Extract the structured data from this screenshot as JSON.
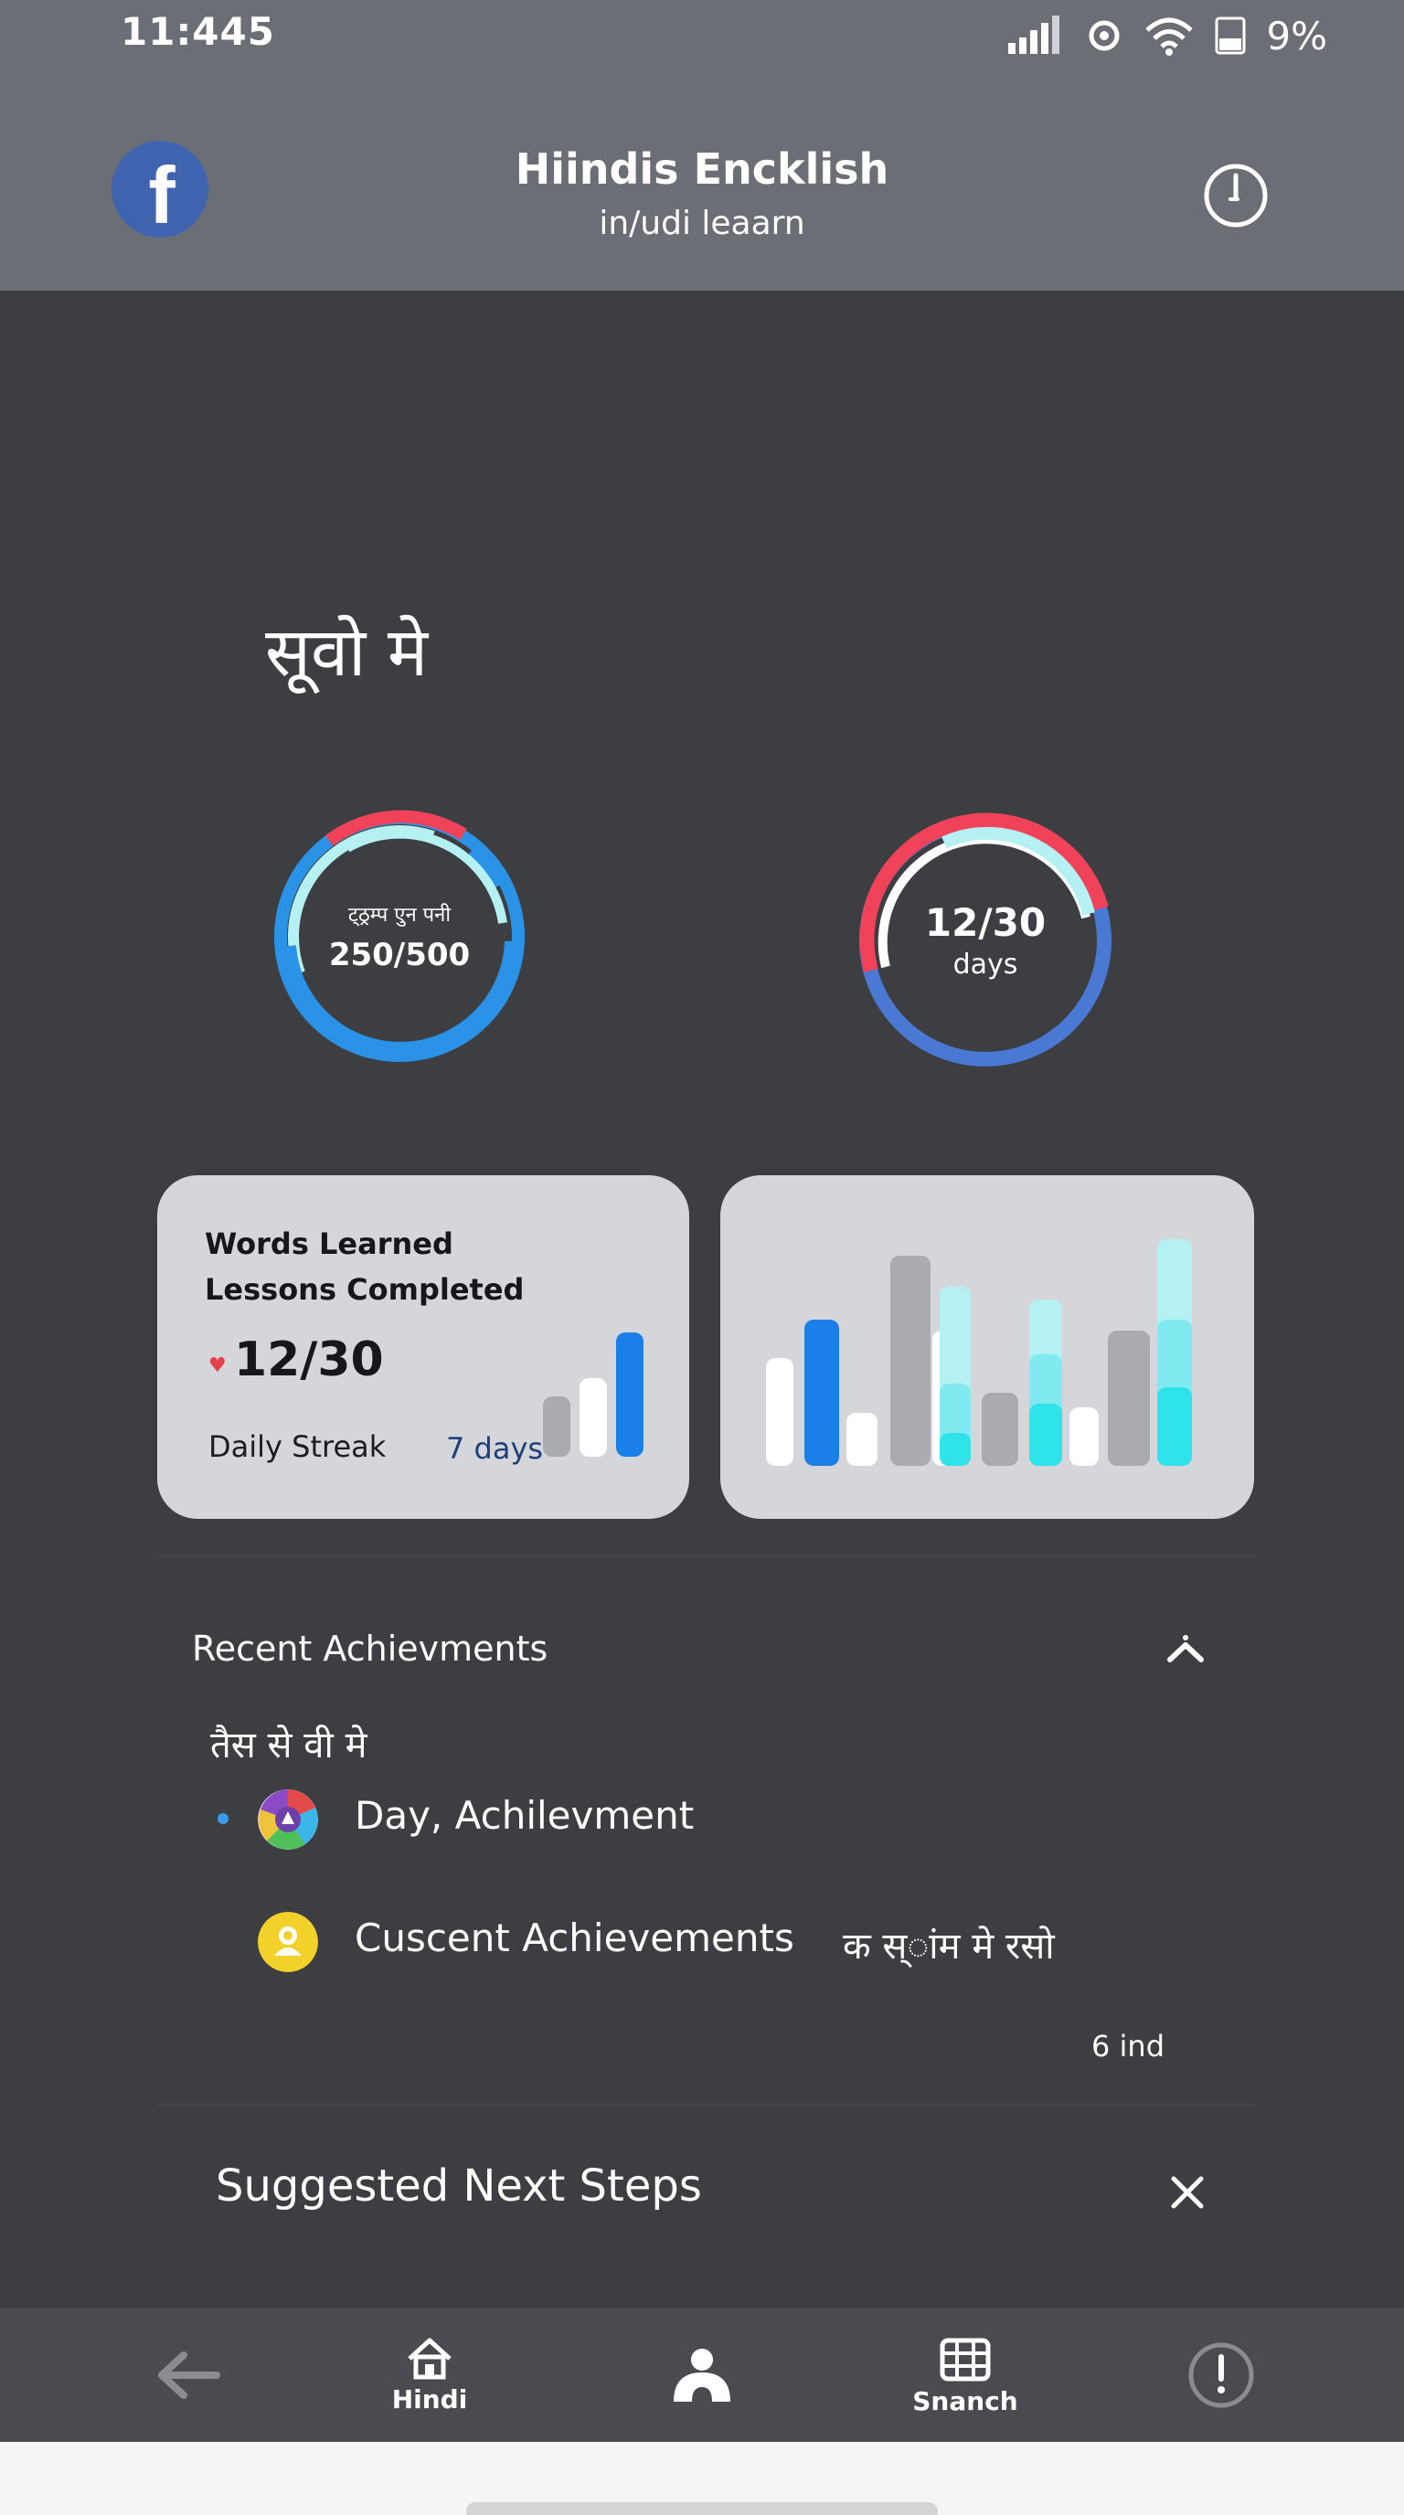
{
  "status_bar": {
    "time": "11:445",
    "battery": "9%"
  },
  "header": {
    "title": "Hiindis Encklish",
    "subtitle": "in/udi leaarn",
    "logo_icon": "facebook-icon",
    "action_icon": "power-icon"
  },
  "main": {
    "title": "सूवो मे"
  },
  "rings": {
    "words": {
      "label": "ट्ठ्रम्प एुन पनी",
      "value": "250/500",
      "progress": 0.5
    },
    "days": {
      "value": "12/30",
      "unit": "days",
      "progress": 0.4
    }
  },
  "stats_card": {
    "line1": "Words Learned",
    "line2": "Lessons Completed",
    "value": "12/30",
    "streak_label": "Daily Streak",
    "streak_days": "7 days",
    "heart_icon": "heart-icon"
  },
  "achievements": {
    "title": "Recent Achievments",
    "subtitle": "तैस से वी मे",
    "items": [
      {
        "label": "Day, Achilevment",
        "icon": "badge-icon"
      },
      {
        "label": "Cuscent Achievements",
        "extra": "क स्ांम मे रसो",
        "icon": "medal-icon"
      }
    ],
    "count": "6 ind"
  },
  "next_steps": {
    "title": "Suggested Next Steps"
  },
  "bottom_nav": {
    "items": [
      {
        "label": "",
        "icon": "back-arrow-icon"
      },
      {
        "label": "Hindi",
        "icon": "home-icon"
      },
      {
        "label": "",
        "icon": "profile-icon"
      },
      {
        "label": "Snanch",
        "icon": "grid-icon"
      },
      {
        "label": "",
        "icon": "info-icon"
      }
    ]
  },
  "colors": {
    "background": "#3d3e42",
    "header": "#6b6e74",
    "card": "#d5d6da",
    "accent_blue": "#2a93e8",
    "accent_red": "#f0435a",
    "accent_cyan": "#b5f0f2"
  }
}
